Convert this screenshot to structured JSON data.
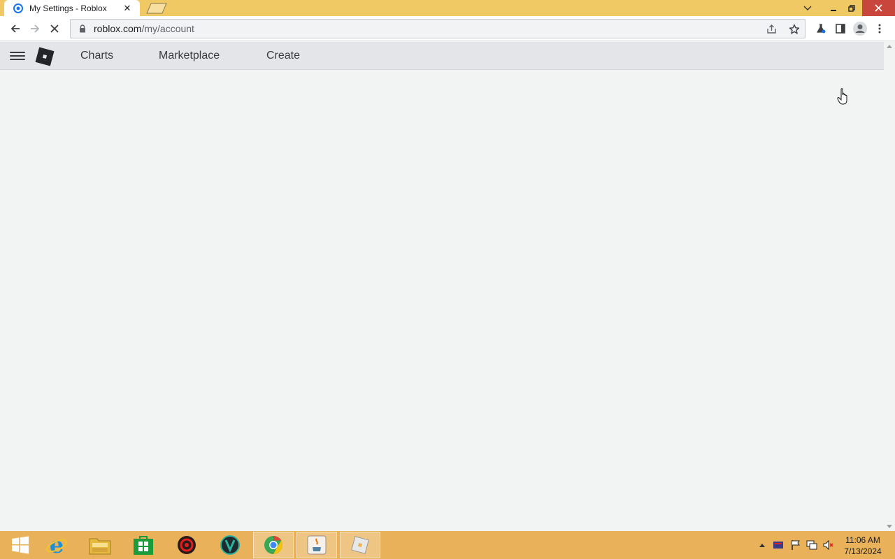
{
  "browser": {
    "tab_title": "My Settings - Roblox",
    "close_glyph": "✕",
    "url_host": "roblox.com",
    "url_path": "/my/account"
  },
  "nav": {
    "links": [
      "Charts",
      "Marketplace",
      "Create"
    ]
  },
  "taskbar": {
    "apps": [
      "start-icon",
      "internet-explorer-icon",
      "file-explorer-icon",
      "store-icon",
      "red-app-icon",
      "teal-app-icon",
      "chrome-icon",
      "java-icon",
      "roblox-icon"
    ],
    "time": "11:06 AM",
    "date": "7/13/2024"
  },
  "colors": {
    "titlebar": "#f0c864",
    "taskbar": "#e9b25a",
    "roblox_nav": "#e3e5e8",
    "page_bg": "#f2f3f3",
    "close_button": "#c9463d"
  }
}
